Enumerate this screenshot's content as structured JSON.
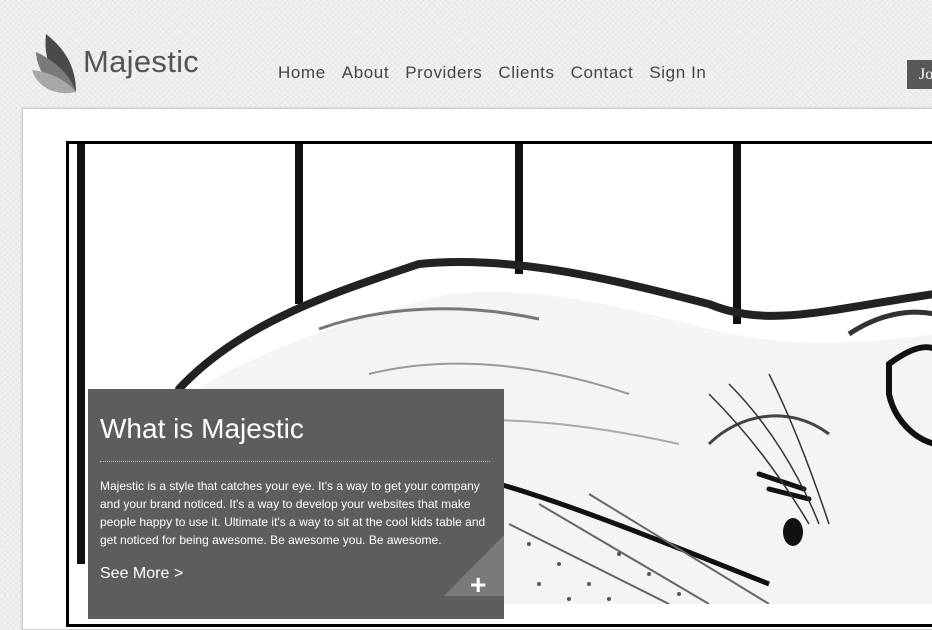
{
  "brand": {
    "name": "Majestic",
    "logo_icon": "leaf-logo-icon"
  },
  "nav": {
    "items": [
      {
        "label": "Home"
      },
      {
        "label": "About"
      },
      {
        "label": "Providers"
      },
      {
        "label": "Clients"
      },
      {
        "label": "Contact"
      },
      {
        "label": "Sign In"
      }
    ]
  },
  "header_button": {
    "label": "Jo"
  },
  "hero": {
    "image_icon": "sleeping-cat-image",
    "panel": {
      "title": "What is Majestic",
      "body": "Majestic is a style that catches your eye. It's a way to get your company and your brand noticed. It's a way to develop your websites that make people happy to use it. Ultimate it's a way to sit at the cool kids table and get noticed for being awesome. Be awesome you. Be awesome.",
      "link_label": "See More >",
      "plus_label": "+"
    }
  },
  "colors": {
    "panel_bg": "#5d5d5d",
    "nav_text": "#444444",
    "brand_text": "#555555"
  }
}
